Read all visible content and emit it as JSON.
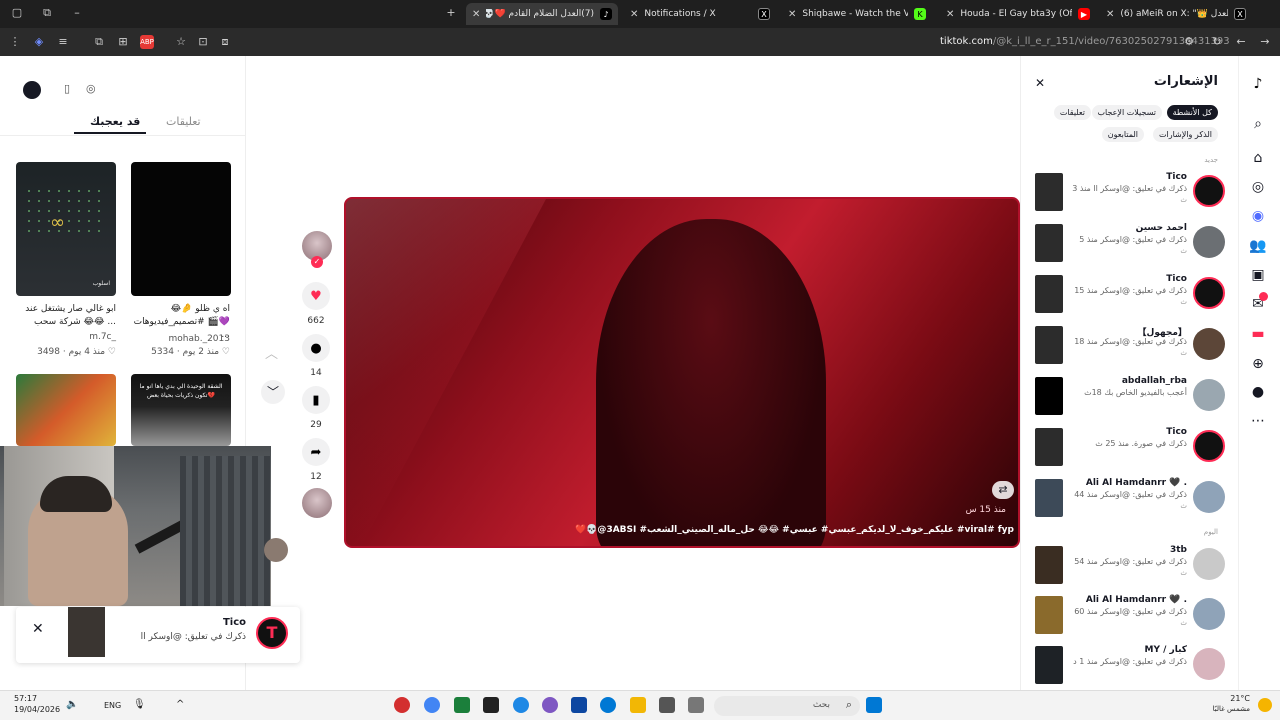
{
  "browser": {
    "tabs": [
      {
        "label": "(7)العدل الضلام القادم ❤️💀@",
        "active": true
      },
      {
        "label": "Notifications / X",
        "active": false
      },
      {
        "label": "Shiqbawe - Watch the VOD on",
        "active": false
      },
      {
        "label": "Houda - El Gay bta3y (Official L",
        "active": false
      },
      {
        "label": "(6) aMeiR on X: \"👑 كمة العدل",
        "active": false
      }
    ],
    "url_host": "tiktok.com",
    "url_path": "/@k_i_ll_e_r_151/video/7630250279136431393"
  },
  "left_panel": {
    "tabs": [
      "تعليقات",
      "قد يعجبك"
    ],
    "active_tab": "قد يعجبك",
    "cards": [
      {
        "caption": "ابو غالي صار يشتغل عند شركة سحب 😂😂 ...",
        "thumb_text": "اسلوب",
        "author": "m.7c_",
        "likes": "3498",
        "age": "منذ 4 يوم"
      },
      {
        "caption": "اه ي ظلو 🤌😂 #تصميم_فيديوهات 🎬💜 ...",
        "thumb_text": "",
        "author": "mohab._2013",
        "likes": "5334",
        "age": "منذ 2 يوم"
      },
      {
        "caption": "",
        "thumb_text": "",
        "author": "",
        "likes": "",
        "age": ""
      },
      {
        "caption": "",
        "thumb_text": "الشقة الوحيدة الي بدي ياها انو ما تكون ذكريات بحياة بعض💔",
        "author": "",
        "likes": "",
        "age": ""
      }
    ]
  },
  "video": {
    "caption": "viral# fyp# عليكم_خوف_لا_لديكم_عبسي# عبسي# 😂😂 حل_ماله_الصيني_الشعب# 3ABSI@💀❤️",
    "time": "منذ 15 س",
    "likes": "662",
    "comments": "14",
    "saves": "29",
    "shares": "12"
  },
  "notifications": {
    "title": "الإشعارات",
    "filters": [
      "كل الأنشطة",
      "تسجيلات الإعجاب",
      "تعليقات",
      "الذكر والإشارات",
      "المتابعون"
    ],
    "active_filter": "كل الأنشطة",
    "sections": {
      "new": "جديد",
      "today": "اليوم"
    },
    "items_new": [
      {
        "name": "Tico",
        "text": "ذكرك في تعليق: @اوسكر اا منذ 3",
        "sub": "ث"
      },
      {
        "name": "احمد حسين",
        "text": "ذكرك في تعليق: @اوسكر منذ 5",
        "sub": "ث"
      },
      {
        "name": "Tico",
        "text": "ذكرك في تعليق: @اوسكر منذ 15",
        "sub": "ث"
      },
      {
        "name": "【مجهول】",
        "text": "ذكرك في تعليق: @اوسكر منذ 18",
        "sub": "ث"
      },
      {
        "name": "abdallah_rba",
        "text": "أعجب بالفيديو الخاص بك 18ث",
        "sub": ""
      },
      {
        "name": "Tico",
        "text": "ذكرك في صورة. منذ 25 ث",
        "sub": ""
      },
      {
        "name": "Ali Al Hamdanrr 🖤 .",
        "text": "ذكرك في تعليق: @اوسكر منذ 44",
        "sub": "ث"
      }
    ],
    "items_today": [
      {
        "name": "3tb",
        "text": "ذكرك في تعليق: @اوسكر منذ 54",
        "sub": "ث"
      },
      {
        "name": "Ali Al Hamdanrr 🖤 .",
        "text": "ذكرك في تعليق: @اوسكر منذ 60",
        "sub": "ث"
      },
      {
        "name": "MY / كبار",
        "text": "ذكرك في تعليق: @اوسكر منذ 1 د",
        "sub": ""
      }
    ]
  },
  "popup": {
    "name": "Tico",
    "text": "ذكرك في تعليق: @اوسكر اا"
  },
  "taskbar": {
    "time": "57:17",
    "date": "19/04/2026",
    "lang": "ENG",
    "search_placeholder": "بحث",
    "weather_temp": "21°C",
    "weather_text": "مشمس غالبًا"
  },
  "colors": {
    "tiktok_red": "#fe2c55",
    "text_dark": "#161823"
  }
}
